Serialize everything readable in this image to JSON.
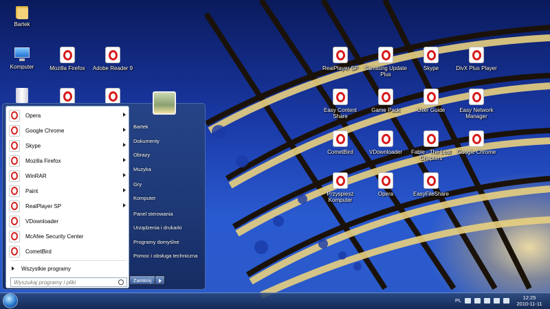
{
  "desktop_icons": {
    "bartek": "Bartek",
    "komputer": "Komputer",
    "mozilla_firefox": "Mozilla Firefox",
    "adobe_reader": "Adobe Reader 9",
    "realplayer": "RealPlayer SP",
    "samsung": "Samsung Update Plus",
    "skype": "Skype",
    "divx": "DivX Plus Player",
    "easy_content": "Easy Content Share",
    "game_pack": "Game Pack",
    "user_guide": "User Guide",
    "easy_network": "Easy Network Manager",
    "cometbird": "CometBird",
    "vdownloader": "VDownloader",
    "fable": "Fable - The Lost Chapters",
    "chrome": "Google Chrome",
    "przyspiesz": "Przyspiesz Komputer",
    "opera": "Opera",
    "easyfileshare": "EasyFileShare"
  },
  "start_menu": {
    "programs": [
      {
        "label": "Opera",
        "submenu": true
      },
      {
        "label": "Google Chrome",
        "submenu": true
      },
      {
        "label": "Skype",
        "submenu": true
      },
      {
        "label": "Mozilla Firefox",
        "submenu": true
      },
      {
        "label": "WinRAR",
        "submenu": true
      },
      {
        "label": "Paint",
        "submenu": true
      },
      {
        "label": "RealPlayer SP",
        "submenu": true
      },
      {
        "label": "VDownloader",
        "submenu": false
      },
      {
        "label": "McAfee Security Center",
        "submenu": false
      },
      {
        "label": "CometBird",
        "submenu": false
      }
    ],
    "all_programs": "Wszystkie programy",
    "search_placeholder": "Wyszukaj programy i pliki",
    "right": {
      "bartek": "Bartek",
      "dokumenty": "Dokumenty",
      "obrazy": "Obrazy",
      "muzyka": "Muzyka",
      "gry": "Gry",
      "komputer": "Komputer",
      "panel": "Panel sterowania",
      "urzadzenia": "Urządzenia i drukarki",
      "domyslne": "Programy domyślne",
      "pomoc": "Pomoc i obsługa techniczna"
    },
    "shutdown": "Zamknij"
  },
  "taskbar": {
    "lang": "PL",
    "time": "12:25",
    "date": "2010-11-11"
  }
}
